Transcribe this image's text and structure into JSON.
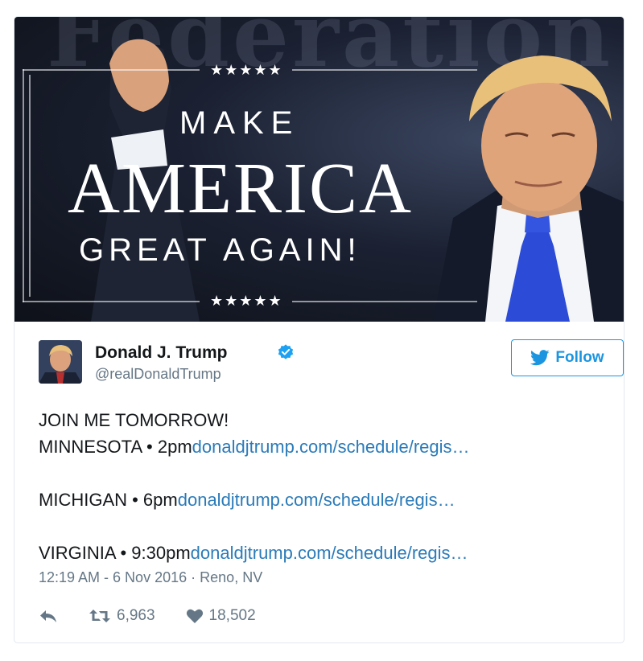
{
  "banner": {
    "background_text": "Federation",
    "stars_top": "★★★★★",
    "stars_bottom": "★★★★★",
    "line1": "MAKE",
    "line2": "AMERICA",
    "line3": "GREAT AGAIN!"
  },
  "tweet": {
    "name": "Donald J. Trump",
    "handle": "@realDonaldTrump",
    "follow_label": "Follow",
    "lines": [
      {
        "text": "JOIN ME TOMORROW!",
        "link": ""
      },
      {
        "text": "MINNESOTA • 2pm",
        "link": "donaldjtrump.com/schedule/regis…"
      },
      {
        "text": "MICHIGAN • 6pm",
        "link": "donaldjtrump.com/schedule/regis…"
      },
      {
        "text": "VIRGINIA • 9:30pm",
        "link": "donaldjtrump.com/schedule/regis…"
      }
    ],
    "timestamp": "12:19 AM - 6 Nov 2016",
    "separator": "·",
    "location": "Reno, NV",
    "retweets": "6,963",
    "likes": "18,502"
  },
  "colors": {
    "accent": "#1b95e0",
    "link": "#2b7bb9",
    "muted": "#657786",
    "verified": "#1da1f2"
  },
  "icons": [
    "verified-badge-icon",
    "twitter-bird-icon",
    "reply-icon",
    "retweet-icon",
    "heart-icon"
  ]
}
